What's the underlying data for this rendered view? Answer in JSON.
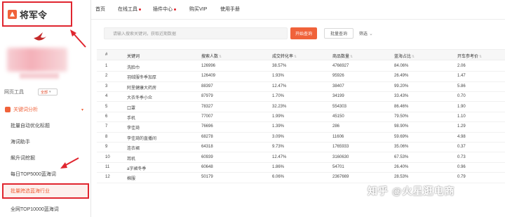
{
  "brand": {
    "name": "将军令",
    "accent": "#f0623a",
    "highlight": "#e0262f"
  },
  "nav": {
    "items": [
      {
        "label": "首页",
        "dot": false
      },
      {
        "label": "在线工具",
        "dot": true
      },
      {
        "label": "插件中心",
        "dot": true
      },
      {
        "label": "购买VIP",
        "dot": false
      },
      {
        "label": "使用手册",
        "dot": false
      }
    ]
  },
  "sidebar": {
    "tools_label": "网页工具",
    "tools_select": "全部",
    "group_label": "关键词分析",
    "items": [
      {
        "label": "批量自动优化标题",
        "active": false
      },
      {
        "label": "海词助手",
        "active": false
      },
      {
        "label": "飙升词挖掘",
        "active": false
      },
      {
        "label": "每日TOP5000蓝海词",
        "active": false
      },
      {
        "label": "批量跨选蓝海行业",
        "active": true
      },
      {
        "label": "全网TOP10000蓝海词",
        "active": false
      }
    ]
  },
  "search": {
    "placeholder": "请输入搜索关键词，获取近期数据",
    "button": "开始查询",
    "batch": "批量查询",
    "filter": "筛选"
  },
  "table": {
    "headers": [
      "#",
      "关键词",
      "搜索人数",
      "成交转化率",
      "商品数量",
      "蓝海占比",
      "开车参考价"
    ],
    "rows": [
      [
        "1",
        "洗脸巾",
        "126996",
        "38.57%",
        "4766927",
        "84.06%",
        "2.06"
      ],
      [
        "2",
        "羽绒服冬季加厚",
        "126409",
        "1.93%",
        "95926",
        "26.49%",
        "1.47"
      ],
      [
        "3",
        "阿里健康大药房",
        "88397",
        "12.47%",
        "38407",
        "99.20%",
        "5.86"
      ],
      [
        "4",
        "大衣冬季小众",
        "87979",
        "1.70%",
        "34199",
        "33.43%",
        "0.70"
      ],
      [
        "5",
        "口罩",
        "78327",
        "32.23%",
        "554303",
        "86.46%",
        "1.90"
      ],
      [
        "6",
        "手机",
        "77007",
        "1.99%",
        "45150",
        "79.50%",
        "1.10"
      ],
      [
        "7",
        "李佳琦",
        "76696",
        "1.39%",
        "286",
        "98.90%",
        "1.29"
      ],
      [
        "8",
        "李佳琦的直播间",
        "68278",
        "3.09%",
        "11606",
        "59.69%",
        "4.98"
      ],
      [
        "9",
        "连衣裙",
        "64318",
        "9.73%",
        "1765933",
        "35.06%",
        "0.37"
      ],
      [
        "10",
        "耳机",
        "60939",
        "12.47%",
        "3160630",
        "67.53%",
        "0.73"
      ],
      [
        "11",
        "a字裙冬季",
        "60648",
        "1.86%",
        "54701",
        "26.40%",
        "0.96"
      ],
      [
        "12",
        "棉服",
        "50179",
        "6.06%",
        "2367669",
        "28.53%",
        "0.79"
      ]
    ]
  },
  "watermark": "知乎 @火星逛电商"
}
